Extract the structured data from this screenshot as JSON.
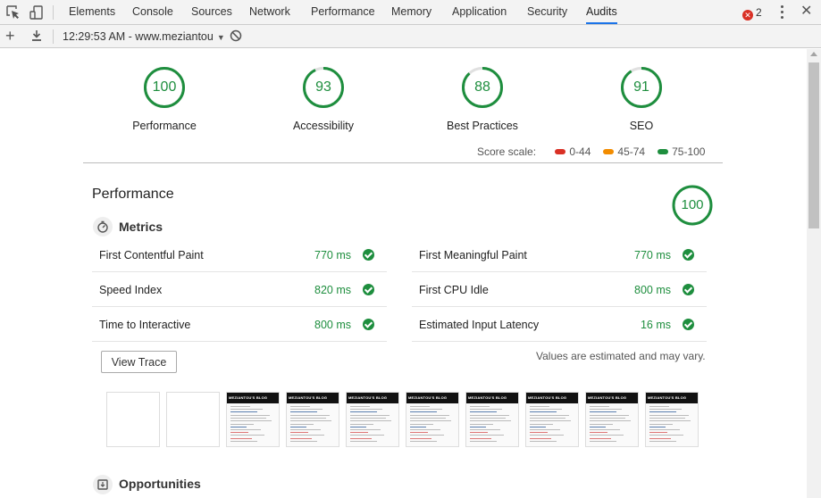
{
  "devtools": {
    "tabs": [
      "Elements",
      "Console",
      "Sources",
      "Network",
      "Performance",
      "Memory",
      "Application",
      "Security",
      "Audits"
    ],
    "active_tab": "Audits",
    "error_count": "2",
    "report_label": "12:29:53 AM - www.meziantou",
    "icons": [
      "inspect-element-icon",
      "device-toolbar-icon",
      "more-vert-icon",
      "close-icon",
      "plus-icon",
      "download-icon",
      "block-icon",
      "dropdown-caret-icon"
    ]
  },
  "scores": [
    {
      "label": "Performance",
      "value": "100",
      "fraction": 1.0
    },
    {
      "label": "Accessibility",
      "value": "93",
      "fraction": 0.93
    },
    {
      "label": "Best Practices",
      "value": "88",
      "fraction": 0.88
    },
    {
      "label": "SEO",
      "value": "91",
      "fraction": 0.91
    }
  ],
  "score_scale": {
    "label": "Score scale:",
    "ranges": [
      {
        "label": "0-44",
        "color": "#d93025"
      },
      {
        "label": "45-74",
        "color": "#f28c00"
      },
      {
        "label": "75-100",
        "color": "#1e8e3e"
      }
    ]
  },
  "performance": {
    "title": "Performance",
    "score": "100",
    "metrics_title": "Metrics",
    "metrics": [
      {
        "name": "First Contentful Paint",
        "value": "770 ms"
      },
      {
        "name": "First Meaningful Paint",
        "value": "770 ms"
      },
      {
        "name": "Speed Index",
        "value": "820 ms"
      },
      {
        "name": "First CPU Idle",
        "value": "800 ms"
      },
      {
        "name": "Time to Interactive",
        "value": "800 ms"
      },
      {
        "name": "Estimated Input Latency",
        "value": "16 ms"
      }
    ],
    "view_trace_label": "View Trace",
    "note": "Values are estimated and may vary.",
    "filmstrip_frames": [
      {
        "blank": true
      },
      {
        "blank": true
      },
      {
        "blank": false,
        "header": "MEZIANTOU'S BLOG"
      },
      {
        "blank": false,
        "header": "MEZIANTOU'S BLOG"
      },
      {
        "blank": false,
        "header": "MEZIANTOU'S BLOG"
      },
      {
        "blank": false,
        "header": "MEZIANTOU'S BLOG"
      },
      {
        "blank": false,
        "header": "MEZIANTOU'S BLOG"
      },
      {
        "blank": false,
        "header": "MEZIANTOU'S BLOG"
      },
      {
        "blank": false,
        "header": "MEZIANTOU'S BLOG"
      },
      {
        "blank": false,
        "header": "MEZIANTOU'S BLOG"
      }
    ],
    "opportunities_title": "Opportunities"
  },
  "colors": {
    "pass": "#1e8e3e",
    "accent": "#1a73e8"
  }
}
